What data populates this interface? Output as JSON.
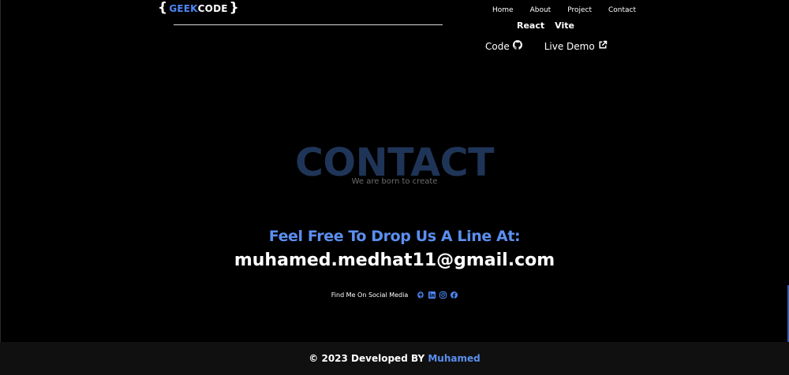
{
  "colors": {
    "background": "#000000",
    "accent": "#5b8ff0",
    "heading_muted": "#1f3558",
    "footer_bg": "#101010"
  },
  "navbar": {
    "logo": {
      "open_brace": "{",
      "geek": "GEEK",
      "code": "CODE",
      "close_brace": "}"
    },
    "links": [
      "Home",
      "About",
      "Project",
      "Contact"
    ]
  },
  "project": {
    "tech": [
      "React",
      "Vite"
    ],
    "code_label": "Code",
    "code_icon": "github-icon",
    "demo_label": "Live Demo",
    "demo_icon": "external-link-icon"
  },
  "contact": {
    "heading": "CONTACT",
    "subtitle": "We are born to create",
    "drop_line": "Feel Free To Drop Us A Line At:",
    "email": "muhamed.medhat11@gmail.com",
    "social_label": "Find Me On Social Media",
    "social_icons": [
      "github-icon",
      "linkedin-icon",
      "instagram-icon",
      "facebook-icon"
    ]
  },
  "footer": {
    "prefix": "© 2023 Developed BY ",
    "name": "Muhamed"
  }
}
